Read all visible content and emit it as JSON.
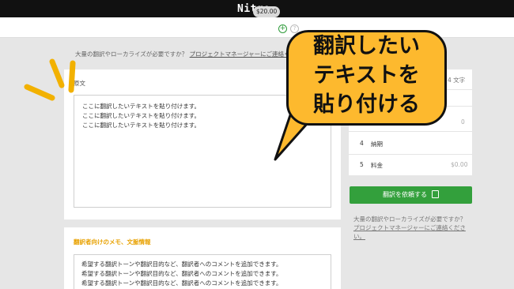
{
  "header": {
    "logo": "Nitro_"
  },
  "subbar": {
    "balance": "$20.00",
    "add_icon": "plus-icon",
    "info_icon": "info-icon"
  },
  "notice": {
    "prefix": "大量の翻訳やローカライズが必要ですか？ ",
    "link": "プロジェクトマネージャーにご連絡ください。"
  },
  "source": {
    "label": "原文",
    "lines": [
      "ここに翻訳したいテキストを貼り付けます。",
      "ここに翻訳したいテキストを貼り付けます。",
      "ここに翻訳したいテキストを貼り付けます。"
    ]
  },
  "memo": {
    "label": "翻訳者向けのメモ、文脈情報",
    "lines": [
      "希望する翻訳トーンや翻訳目的など、翻訳者へのコメントを追加できます。",
      "希望する翻訳トーンや翻訳目的など、翻訳者へのコメントを追加できます。",
      "希望する翻訳トーンや翻訳目的など、翻訳者へのコメントを追加できます。"
    ]
  },
  "sidebar": {
    "count": "4 文字",
    "row2_value": "0",
    "rows": [
      {
        "num": "4",
        "label": "納期",
        "value": ""
      },
      {
        "num": "5",
        "label": "料金",
        "value": "$0.00"
      }
    ],
    "order_button": "翻訳を依頼する",
    "order_icon": "document-icon",
    "note_prefix": "大量の翻訳やローカライズが必要ですか？",
    "note_link": "プロジェクトマネージャーにご連絡ください。"
  },
  "callout": {
    "lines": [
      "翻訳したい",
      "テキストを",
      "貼り付ける"
    ]
  },
  "colors": {
    "accent": "#fdb92e",
    "button": "#33a03c",
    "header": "#111111",
    "memo_label": "#e8a100"
  }
}
